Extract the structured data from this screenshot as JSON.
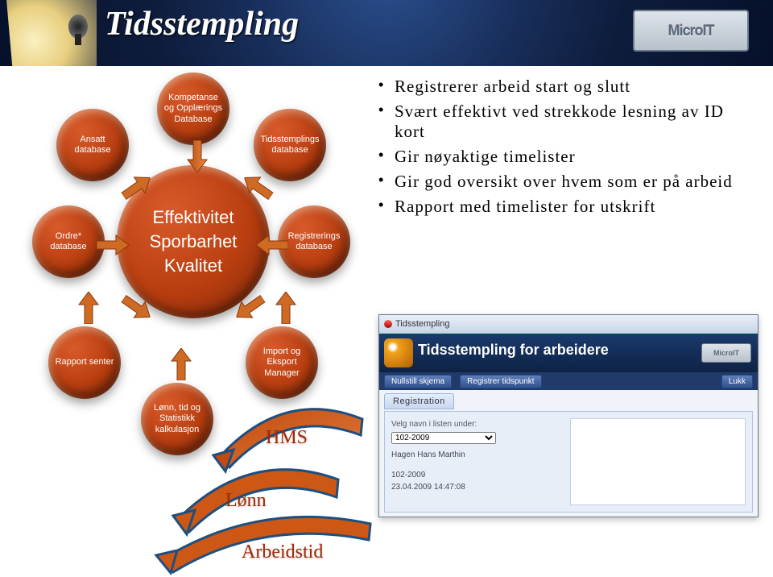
{
  "header": {
    "title": "Tidsstempling",
    "logo_text": "MicroIT"
  },
  "bullets": [
    "Registrerer arbeid start og slutt",
    "Svært effektivt ved strekkode lesning av ID kort",
    "Gir nøyaktige timelister",
    "Gir god oversikt over hvem som er på arbeid",
    "Rapport med timelister for utskrift"
  ],
  "center_circle": "Effektivitet\nSporbarhet\nKvalitet",
  "satellites": {
    "ansatt": "Ansatt\ndatabase",
    "ordre": "Ordre*\ndatabase",
    "kompetanse": "Kompetanse\nog Opplærings\nDatabase",
    "tidsstemp": "Tidsstemplings\ndatabase",
    "registrer": "Registrerings\ndatabase",
    "rapport": "Rapport senter",
    "import": "Import og\nEksport\nManager",
    "lonn": "Lønn, tid og\nStatistikk\nkalkulasjon"
  },
  "swoosh_labels": {
    "hms": "HMS",
    "lonn": "Lønn",
    "arbeidstid": "Arbeidstid"
  },
  "inset": {
    "window_title": "Tidsstempling",
    "banner_title": "Tidsstempling for arbeidere",
    "tab_nullstill": "Nullstill skjema",
    "tab_registrer": "Registrer tidspunkt",
    "tab_lukk": "Lukk",
    "panel_tab": "Registration",
    "list_label": "Velg navn i listen under:",
    "select_value": "102-2009",
    "line_name": "Hagen Hans Marthin",
    "line_code": "102-2009",
    "line_time": "23.04.2009 14:47:08",
    "logo_small": "MicroIT"
  }
}
